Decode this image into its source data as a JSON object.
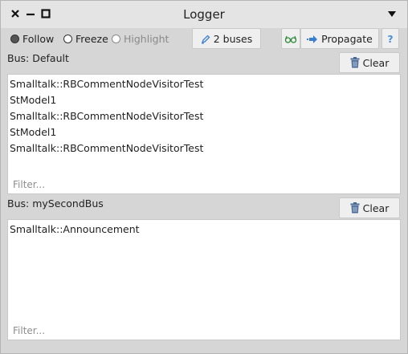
{
  "window": {
    "title": "Logger"
  },
  "toolbar": {
    "radios": [
      {
        "label": "Follow",
        "selected": true,
        "enabled": true
      },
      {
        "label": "Freeze",
        "selected": false,
        "enabled": true
      },
      {
        "label": "Highlight",
        "selected": false,
        "enabled": false
      }
    ],
    "buses_label": "2 buses",
    "propagate_label": "Propagate",
    "help_label": "?"
  },
  "buses": [
    {
      "label": "Bus: Default",
      "clear_label": "Clear",
      "entries": [
        "Smalltalk::RBCommentNodeVisitorTest",
        "StModel1",
        "Smalltalk::RBCommentNodeVisitorTest",
        "StModel1",
        "Smalltalk::RBCommentNodeVisitorTest"
      ],
      "filter_placeholder": "Filter..."
    },
    {
      "label": "Bus: mySecondBus",
      "clear_label": "Clear",
      "entries": [
        "Smalltalk::Announcement"
      ],
      "filter_placeholder": "Filter..."
    }
  ],
  "colors": {
    "accent": "#3a7fcf",
    "trash": "#4a6a96"
  },
  "icons": [
    "close-icon",
    "minimize-icon",
    "maximize-icon",
    "window-menu-icon",
    "pencil-icon",
    "glasses-icon",
    "arrow-right-icon",
    "trash-icon"
  ]
}
